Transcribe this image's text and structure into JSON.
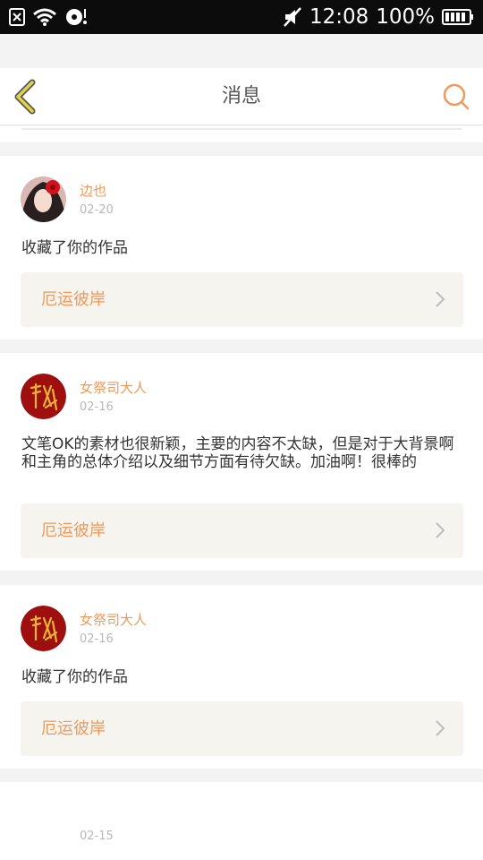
{
  "status_bar": {
    "time": "12:08",
    "battery": "100%"
  },
  "header": {
    "title": "消息"
  },
  "messages": [
    {
      "username": "边也",
      "date": "02-20",
      "text": "收藏了你的作品",
      "work_title": "厄运彼岸"
    },
    {
      "username": "女祭司大人",
      "date": "02-16",
      "text": "文笔OK的素材也很新颖，主要的内容不太缺，但是对于大背景啊和主角的总体介绍以及细节方面有待欠缺。加油啊！很棒的",
      "work_title": "厄运彼岸"
    },
    {
      "username": "女祭司大人",
      "date": "02-16",
      "text": "收藏了你的作品",
      "work_title": "厄运彼岸"
    },
    {
      "date": "02-15"
    }
  ],
  "colors": {
    "accent": "#f0995a",
    "back_arrow": "#e1d44a",
    "work_bg": "#f5f4ef",
    "date_gray": "#b8b8b8"
  }
}
